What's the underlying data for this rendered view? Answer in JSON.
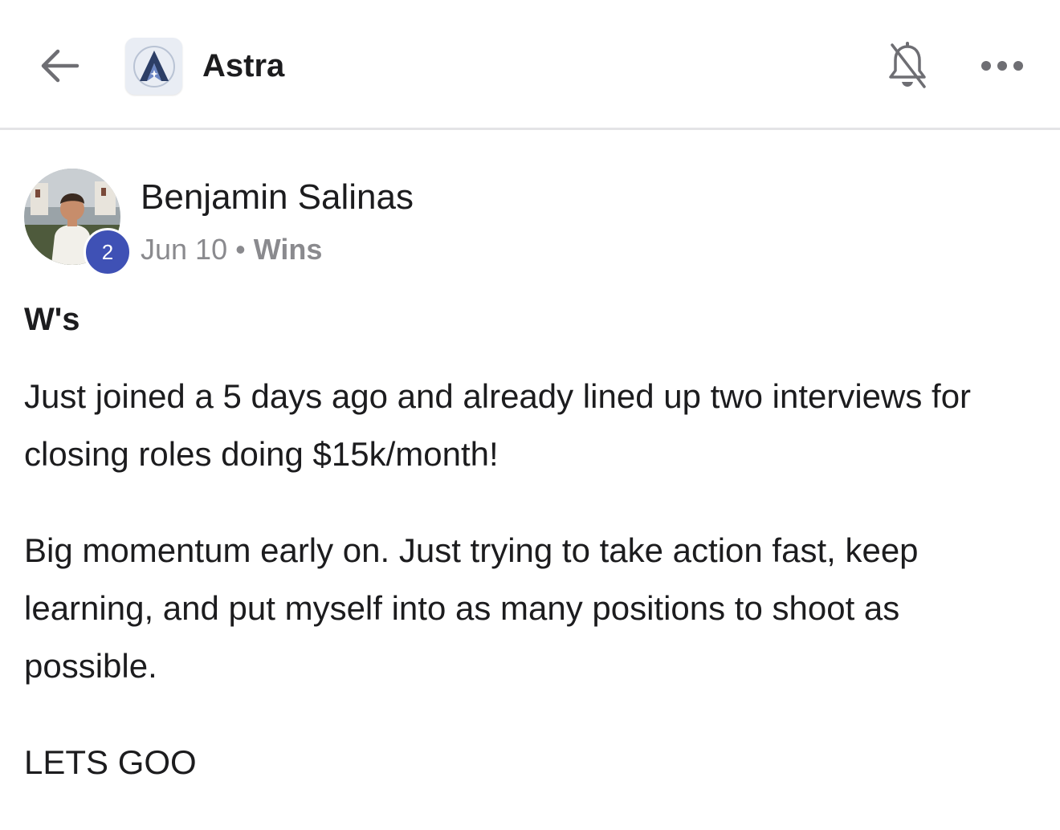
{
  "header": {
    "app_title": "Astra",
    "back_icon": "arrow-left-icon",
    "logo_icon": "astra-logo-icon",
    "bell_icon": "bell-muted-icon",
    "more_icon": "more-horizontal-icon"
  },
  "post": {
    "author": {
      "name": "Benjamin Salinas",
      "level": "2"
    },
    "date": "Jun 10",
    "separator": "•",
    "category": "Wins",
    "title": "W's",
    "paragraphs": [
      "Just joined a 5 days ago and already lined up two interviews for closing roles doing $15k/month!",
      "Big momentum early on. Just trying to take action fast, keep learning, and put myself into as many positions to shoot as possible.",
      "LETS GOO"
    ]
  },
  "colors": {
    "level_badge": "#3f51b5",
    "meta_text": "#8a8a8e",
    "divider": "#e4e4e6"
  }
}
